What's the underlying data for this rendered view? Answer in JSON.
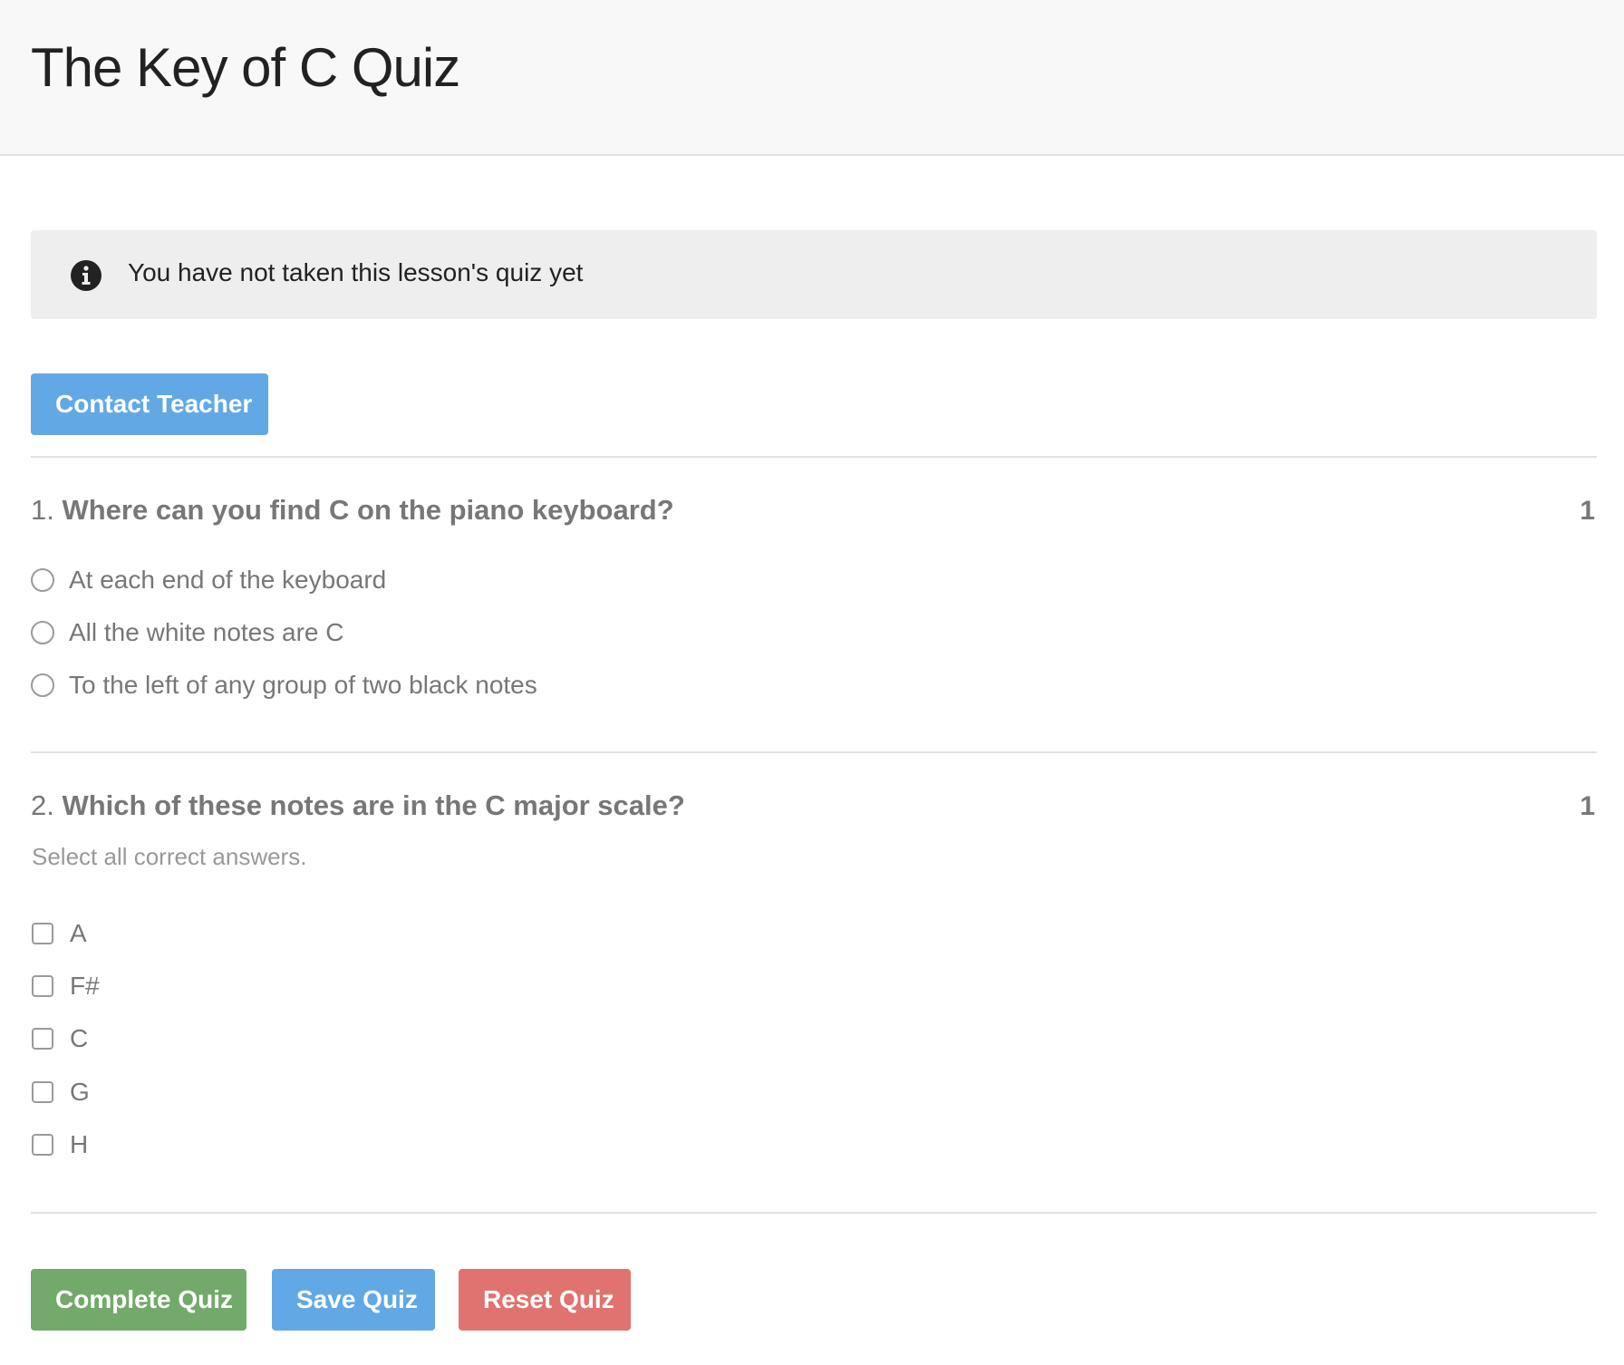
{
  "header": {
    "title": "The Key of C Quiz"
  },
  "notice": {
    "icon": "info-circle-icon",
    "text": "You have not taken this lesson's quiz yet"
  },
  "actions": {
    "contact_label": "Contact Teacher",
    "complete_label": "Complete Quiz",
    "save_label": "Save Quiz",
    "reset_label": "Reset Quiz"
  },
  "questions": [
    {
      "number": "1.",
      "text": "Where can you find C on the piano keyboard?",
      "points": "1",
      "type": "radio",
      "options": [
        {
          "label": "At each end of the keyboard",
          "selected": false
        },
        {
          "label": "All the white notes are C",
          "selected": false
        },
        {
          "label": "To the left of any group of two black notes",
          "selected": false
        }
      ]
    },
    {
      "number": "2.",
      "text": "Which of these notes are in the C major scale?",
      "points": "1",
      "type": "checkbox",
      "hint": "Select all correct answers.",
      "options": [
        {
          "label": "A",
          "checked": false
        },
        {
          "label": "F#",
          "checked": false
        },
        {
          "label": "C",
          "checked": false
        },
        {
          "label": "G",
          "checked": false
        },
        {
          "label": "H",
          "checked": false
        }
      ]
    }
  ],
  "colors": {
    "primary": "#62a8e5",
    "success": "#73a96b",
    "danger": "#e0736f"
  }
}
